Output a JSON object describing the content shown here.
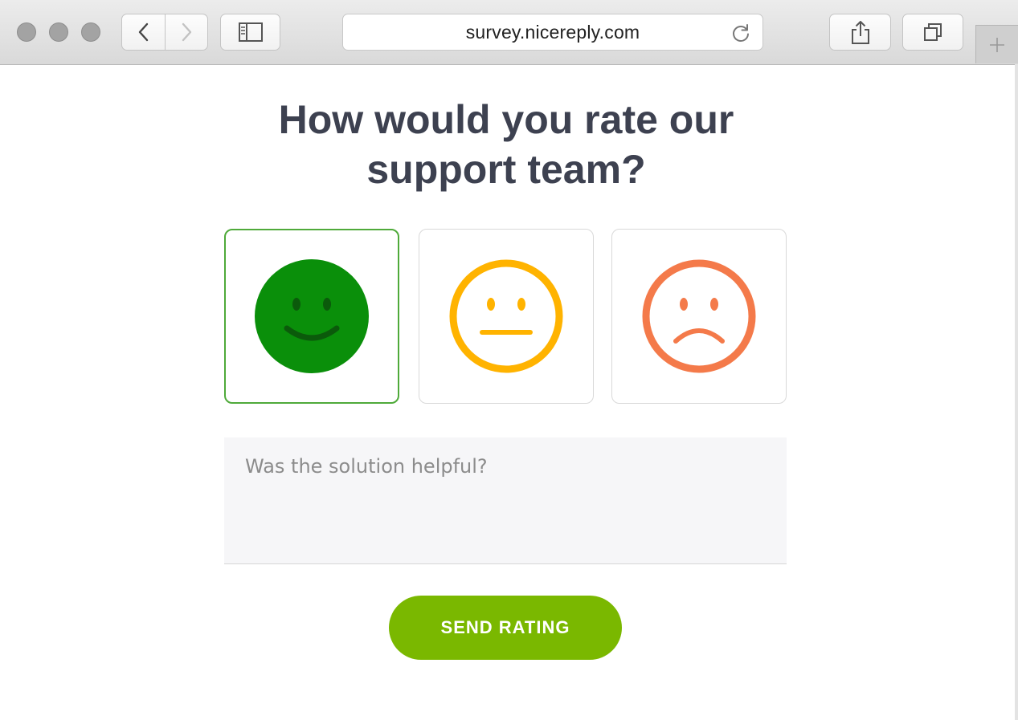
{
  "browser": {
    "url": "survey.nicereply.com",
    "icons": {
      "back": "chevron-left-icon",
      "forward": "chevron-right-icon",
      "sidebar": "sidebar-icon",
      "reload": "reload-icon",
      "share": "share-icon",
      "tabs": "tabs-overview-icon",
      "new_tab": "plus-icon"
    }
  },
  "survey": {
    "title": "How would you rate our support team?",
    "ratings": [
      {
        "name": "happy",
        "icon": "happy-face-icon",
        "color": "#0a8f0a",
        "selected": true
      },
      {
        "name": "neutral",
        "icon": "neutral-face-icon",
        "color": "#ffb300",
        "selected": false
      },
      {
        "name": "sad",
        "icon": "sad-face-icon",
        "color": "#f47a4a",
        "selected": false
      }
    ],
    "comment_placeholder": "Was the solution helpful?",
    "comment_value": "",
    "submit_label": "SEND RATING",
    "submit_color": "#7ab800"
  }
}
